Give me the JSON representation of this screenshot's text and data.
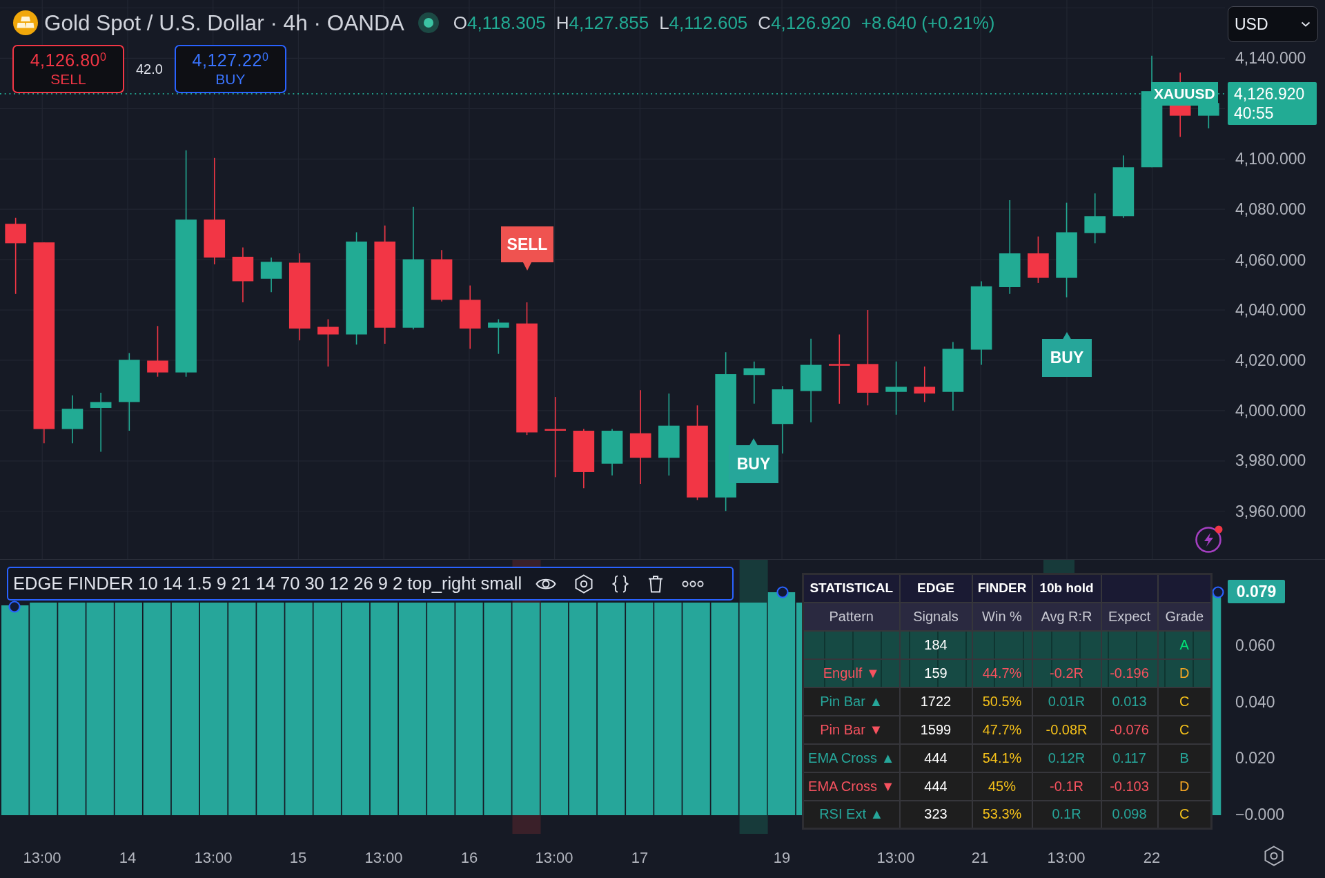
{
  "header": {
    "symbol": "Gold Spot / U.S. Dollar · 4h · OANDA",
    "market_open": true,
    "rising": true,
    "ohlc": [
      {
        "letter": "O",
        "value": "4,118.305"
      },
      {
        "letter": "H",
        "value": "4,127.855"
      },
      {
        "letter": "L",
        "value": "4,112.605"
      },
      {
        "letter": "C",
        "value": "4,126.920"
      }
    ],
    "change": "+8.640 (+0.21%)"
  },
  "trade": {
    "sell": {
      "price": "4,126.80$^{0}$",
      "label": "SELL"
    },
    "spread": "42.0",
    "buy": {
      "price": "4,127.22$^{0}$",
      "label": "BUY"
    }
  },
  "currency": "USD",
  "price_axis": {
    "labels": [
      "4,140.000",
      "4,100.000",
      "4,080.000",
      "4,060.000",
      "4,040.000",
      "4,020.000",
      "4,000.000",
      "3,980.000",
      "3,960.000"
    ],
    "symbol_tag": "XAUUSD",
    "last_price": "4,126.920",
    "countdown": "40:55"
  },
  "signals": [
    {
      "kind": "sell",
      "label": "SELL"
    },
    {
      "kind": "buy",
      "label": "BUY"
    },
    {
      "kind": "buy",
      "label": "BUY"
    }
  ],
  "indicator": {
    "title": "EDGE FINDER 10 14 1.5 9 21 14 70 30 12 26 9 2 top_right small",
    "selected": true,
    "value": "0.079",
    "axis_labels": [
      "0.060",
      "0.040",
      "0.020",
      "−0.000"
    ]
  },
  "table": {
    "title": [
      "STATISTICAL",
      "EDGE",
      "FINDER",
      "10b hold"
    ],
    "columns": [
      "Pattern",
      "Signals",
      "Win %",
      "Avg R:R",
      "Expect",
      "Grade"
    ],
    "rows": [
      {
        "covered": true,
        "signals": {
          "text": "184",
          "color": "#ffffff"
        },
        "grade": {
          "text": "A",
          "color": "#00e676"
        }
      },
      {
        "covered": true,
        "pattern": {
          "text": "Engulf ▼",
          "color": "#f7525f"
        },
        "signals": {
          "text": "159",
          "color": "#ffffff"
        },
        "win": {
          "text": "44.7%",
          "color": "#f7525f"
        },
        "rr": {
          "text": "-0.2R",
          "color": "#f7525f"
        },
        "expect": {
          "text": "-0.196",
          "color": "#f7525f"
        },
        "grade": {
          "text": "D",
          "color": "#f5a623"
        }
      },
      {
        "covered": false,
        "pattern": {
          "text": "Pin Bar ▲",
          "color": "#26a69a"
        },
        "signals": {
          "text": "1722",
          "color": "#ffffff"
        },
        "win": {
          "text": "50.5%",
          "color": "#f6c21a"
        },
        "rr": {
          "text": "0.01R",
          "color": "#26a69a"
        },
        "expect": {
          "text": "0.013",
          "color": "#26a69a"
        },
        "grade": {
          "text": "C",
          "color": "#f6c21a"
        }
      },
      {
        "covered": false,
        "pattern": {
          "text": "Pin Bar ▼",
          "color": "#f7525f"
        },
        "signals": {
          "text": "1599",
          "color": "#ffffff"
        },
        "win": {
          "text": "47.7%",
          "color": "#f6c21a"
        },
        "rr": {
          "text": "-0.08R",
          "color": "#f6c21a"
        },
        "expect": {
          "text": "-0.076",
          "color": "#f7525f"
        },
        "grade": {
          "text": "C",
          "color": "#f6c21a"
        }
      },
      {
        "covered": false,
        "pattern": {
          "text": "EMA Cross ▲",
          "color": "#26a69a"
        },
        "signals": {
          "text": "444",
          "color": "#ffffff"
        },
        "win": {
          "text": "54.1%",
          "color": "#f6c21a"
        },
        "rr": {
          "text": "0.12R",
          "color": "#26a69a"
        },
        "expect": {
          "text": "0.117",
          "color": "#26a69a"
        },
        "grade": {
          "text": "B",
          "color": "#26a69a"
        }
      },
      {
        "covered": false,
        "pattern": {
          "text": "EMA Cross ▼",
          "color": "#f7525f"
        },
        "signals": {
          "text": "444",
          "color": "#ffffff"
        },
        "win": {
          "text": "45%",
          "color": "#f6c21a"
        },
        "rr": {
          "text": "-0.1R",
          "color": "#f7525f"
        },
        "expect": {
          "text": "-0.103",
          "color": "#f7525f"
        },
        "grade": {
          "text": "D",
          "color": "#f5a623"
        }
      },
      {
        "covered": false,
        "pattern": {
          "text": "RSI Ext ▲",
          "color": "#26a69a"
        },
        "signals": {
          "text": "323",
          "color": "#ffffff"
        },
        "win": {
          "text": "53.3%",
          "color": "#f6c21a"
        },
        "rr": {
          "text": "0.1R",
          "color": "#26a69a"
        },
        "expect": {
          "text": "0.098",
          "color": "#26a69a"
        },
        "grade": {
          "text": "C",
          "color": "#f6c21a"
        }
      }
    ]
  },
  "time_axis": [
    "13:00",
    "14",
    "13:00",
    "15",
    "13:00",
    "16",
    "13:00",
    "17",
    "19",
    "13:00",
    "21",
    "13:00",
    "22"
  ]
}
